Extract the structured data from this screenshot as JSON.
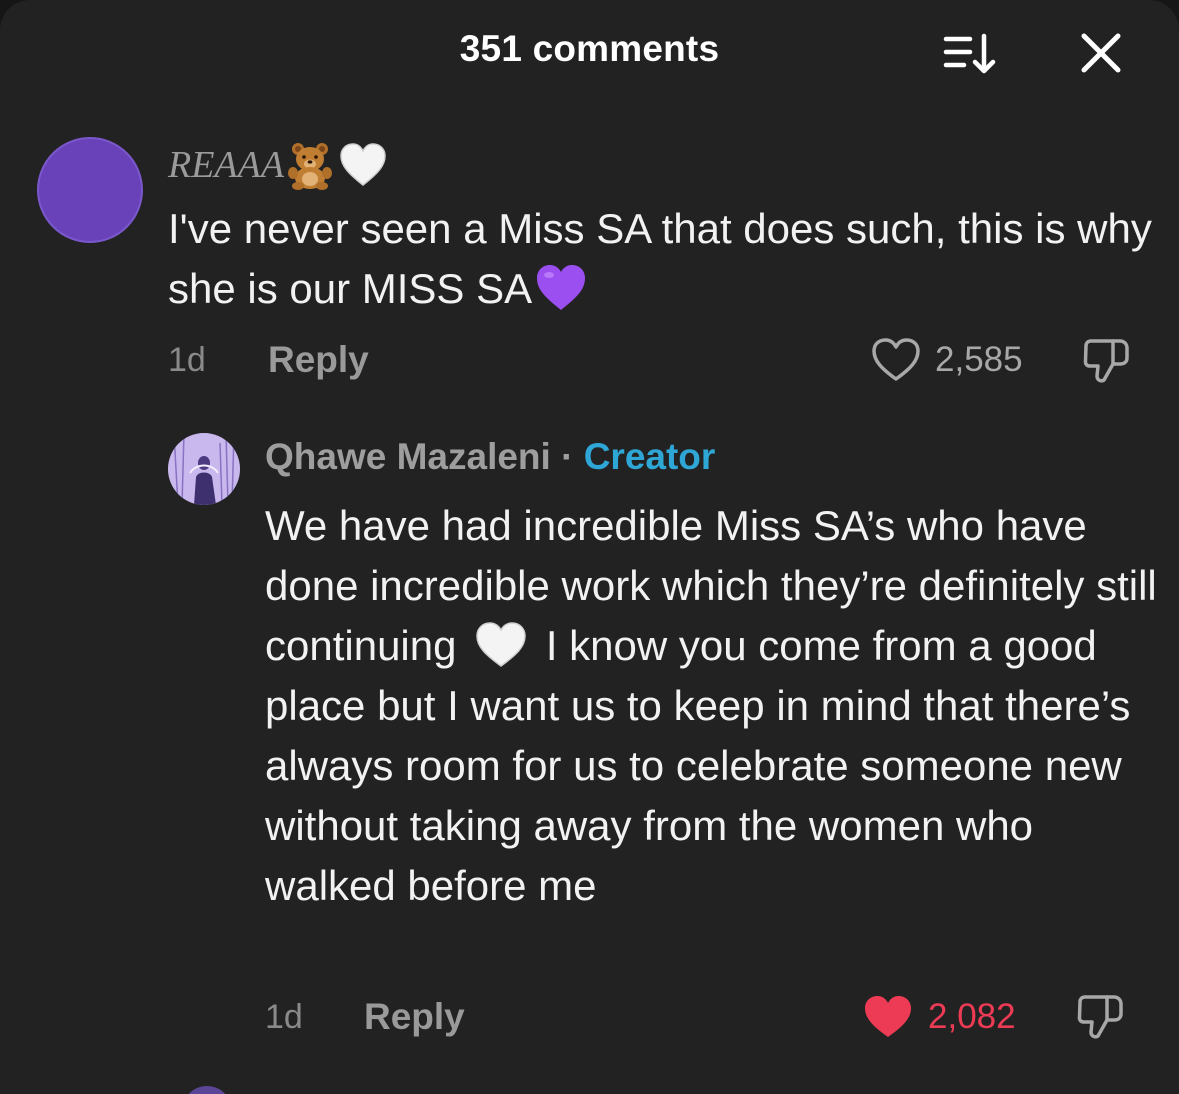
{
  "header": {
    "title": "351 comments"
  },
  "comments": [
    {
      "username": "REAAA",
      "text": "I've never seen a Miss SA that does such, this is why she is our MISS SA",
      "time": "1d",
      "reply_label": "Reply",
      "likes": "2,585",
      "liked": false,
      "replies": [
        {
          "username": "Qhawe Mazaleni",
          "separator": "·",
          "badge": "Creator",
          "text_part1": "We have had incredible Miss SA’s who have done incredible work which they’re definitely still continuing",
          "text_part2": "I know you come from a good place but I want us to keep in mind that there’s always room for us to celebrate someone new without taking away from the women who walked before me",
          "time": "1d",
          "reply_label": "Reply",
          "likes": "2,082",
          "liked": true
        }
      ]
    }
  ],
  "icons": {
    "sort": "sort-icon",
    "close": "close-icon",
    "like": "heart-icon",
    "dislike": "thumbs-down-icon",
    "username_emojis": [
      "teddy-bear-icon",
      "white-heart-icon"
    ],
    "comment_emoji": "purple-heart-icon",
    "reply_emoji": "white-heart-icon"
  },
  "colors": {
    "background": "#222223",
    "creator_badge": "#2fa7d6",
    "liked_heart": "#ee3b55",
    "avatar": "#6942ba"
  }
}
